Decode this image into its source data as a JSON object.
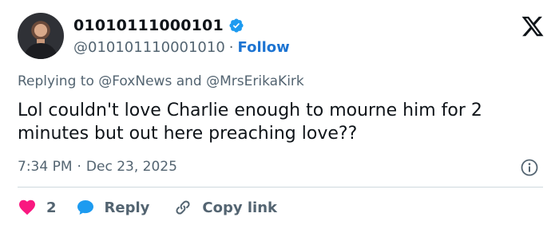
{
  "author": {
    "display_name": "01010111000101",
    "handle": "@010101110001010",
    "follow_label": "Follow",
    "separator": "·"
  },
  "tweet": {
    "replying_to_prefix": "Replying to",
    "mention_1": "@FoxNews",
    "and_word": "and",
    "mention_2": "@MrsErikaKirk",
    "text": "Lol couldn't love Charlie enough to mourne him for 2 minutes but out here preaching love??",
    "time": "7:34 PM",
    "date": "Dec 23, 2025",
    "meta_separator": "·"
  },
  "actions": {
    "like_count": "2",
    "reply_label": "Reply",
    "copy_label": "Copy link"
  },
  "icons": [
    "verified-badge-icon",
    "x-logo-icon",
    "info-icon",
    "heart-icon",
    "reply-bubble-icon",
    "link-icon"
  ],
  "colors": {
    "heart": "#f91880",
    "reply_bubble": "#1d9bf0",
    "verified": "#1d9bf0",
    "follow": "#1d74d2",
    "secondary_text": "#536471"
  }
}
